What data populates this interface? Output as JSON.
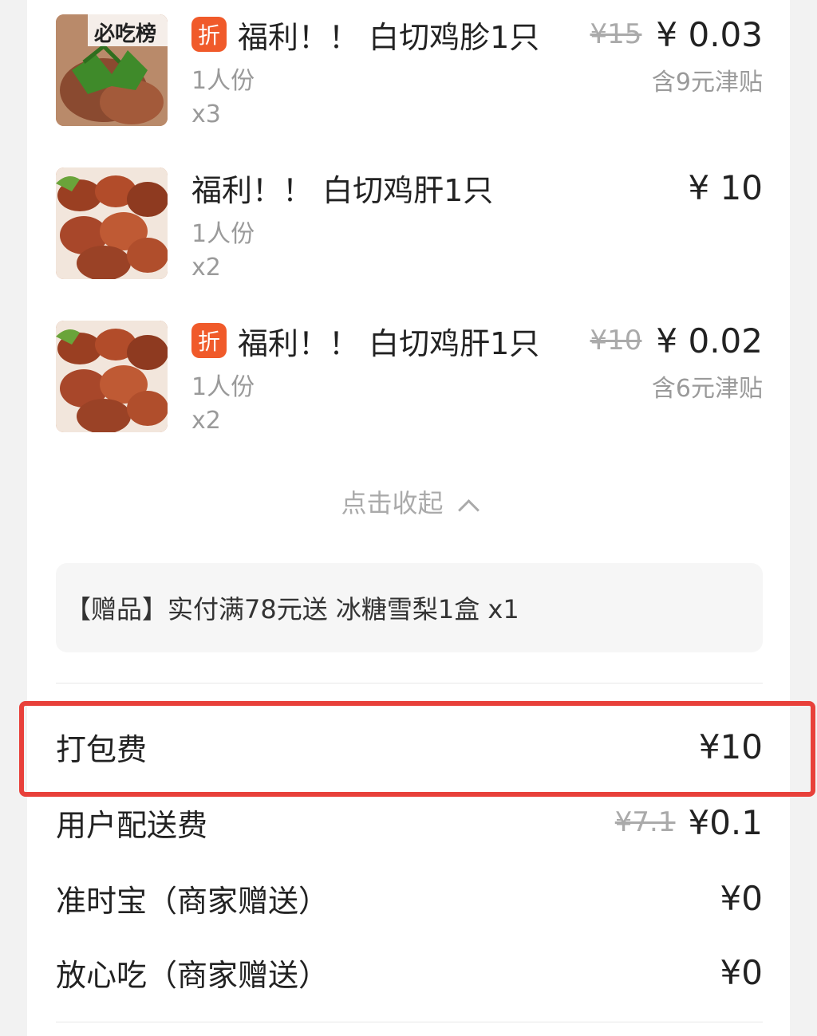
{
  "items": [
    {
      "has_discount_badge": true,
      "badge": "折",
      "title": "福利！！ 白切鸡胗1只",
      "spec": "1人份",
      "qty": "x3",
      "orig_price": "¥15",
      "price": "¥ 0.03",
      "subsidy": "含9元津贴",
      "thumb_label": "必吃榜"
    },
    {
      "has_discount_badge": false,
      "badge": "",
      "title": "福利！！ 白切鸡肝1只",
      "spec": "1人份",
      "qty": "x2",
      "orig_price": "",
      "price": "¥ 10",
      "subsidy": "",
      "thumb_label": ""
    },
    {
      "has_discount_badge": true,
      "badge": "折",
      "title": "福利！！ 白切鸡肝1只",
      "spec": "1人份",
      "qty": "x2",
      "orig_price": "¥10",
      "price": "¥ 0.02",
      "subsidy": "含6元津贴",
      "thumb_label": ""
    }
  ],
  "collapse_label": "点击收起",
  "gift": "【赠品】实付满78元送 冰糖雪梨1盒 x1",
  "fees": [
    {
      "label": "打包费",
      "orig": "",
      "value": "¥10"
    },
    {
      "label": "用户配送费",
      "orig": "¥7.1",
      "value": "¥0.1"
    },
    {
      "label": "准时宝（商家赠送）",
      "orig": "",
      "value": "¥0"
    },
    {
      "label": "放心吃（商家赠送）",
      "orig": "",
      "value": "¥0"
    }
  ],
  "colors": {
    "accent": "#f05a2a",
    "highlight": "#e8403a",
    "muted": "#9a9a9a"
  }
}
